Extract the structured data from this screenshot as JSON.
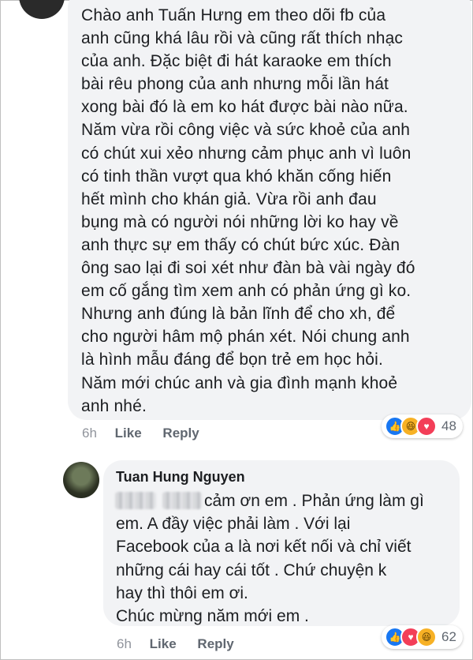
{
  "comment1": {
    "lines": [
      "Chào anh Tuấn Hưng em theo dõi fb của",
      "anh cũng khá lâu rồi và cũng rất thích nhạc",
      "của anh. Đặc biệt đi hát karaoke em thích",
      "bài rêu phong của anh nhưng mỗi lần hát",
      "xong bài đó là em ko hát được bài nào nữa.",
      "Năm vừa rồi công việc và sức khoẻ của anh",
      "có chút xui xẻo nhưng cảm phục anh vì luôn",
      "có tinh thần vượt qua khó khăn cống hiến",
      "hết mình cho khán giả. Vừa rồi anh đau",
      "bụng mà có người nói những lời ko hay về",
      "anh thực sự em thấy có chút bức xúc. Đàn",
      "ông sao lại đi soi xét như đàn bà vài ngày đó",
      "em cố gắng tìm xem anh có phản ứng gì ko.",
      "Nhưng anh đúng là bản lĩnh để cho xh, để",
      "cho người hâm mộ phán xét. Nói chung anh",
      "là hình mẫu đáng để bọn trẻ em học hỏi.",
      "Năm mới chúc anh và gia đình mạnh khoẻ",
      "anh nhé."
    ],
    "time": "6h",
    "like_label": "Like",
    "reply_label": "Reply",
    "reaction_count": "48",
    "reaction_icons": [
      "like-icon",
      "haha-icon",
      "love-icon"
    ]
  },
  "comment2": {
    "author": "Tuan Hung Nguyen",
    "lines": [
      "cảm ơn em . Phản ứng làm gì",
      "em.  A đầy việc phải làm . Với lại",
      "Facebook của a là nơi kết nối và chỉ viết",
      "những cái hay cái tốt . Chứ chuyện k",
      "hay thì thôi em ơi.",
      "Chúc mừng năm mới em ."
    ],
    "time": "6h",
    "like_label": "Like",
    "reply_label": "Reply",
    "reaction_count": "62",
    "reaction_icons": [
      "like-icon",
      "love-icon",
      "haha-icon"
    ]
  }
}
